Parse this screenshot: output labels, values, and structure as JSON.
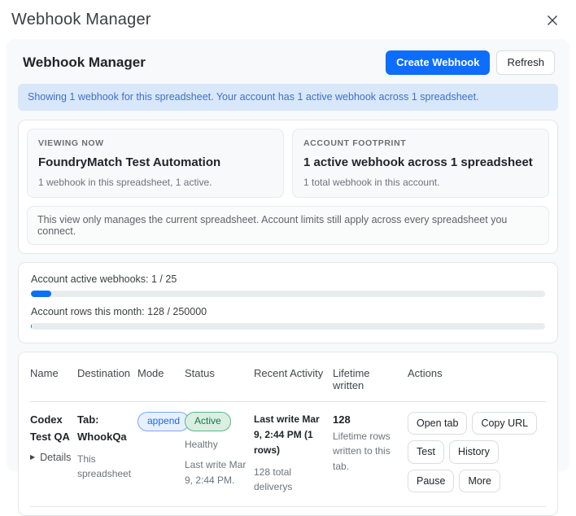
{
  "dialog": {
    "title": "Webhook Manager"
  },
  "header": {
    "title": "Webhook Manager",
    "create_button": "Create Webhook",
    "refresh_button": "Refresh"
  },
  "banner": {
    "text": "Showing 1 webhook for this spreadsheet. Your account has 1 active webhook across 1 spreadsheet."
  },
  "overview": {
    "viewing_now": {
      "label": "VIEWING NOW",
      "title": "FoundryMatch Test Automation",
      "subtitle": "1 webhook in this spreadsheet, 1 active."
    },
    "account_footprint": {
      "label": "ACCOUNT FOOTPRINT",
      "title": "1 active webhook across 1 spreadsheet",
      "subtitle": "1 total webhook in this account."
    },
    "note": "This view only manages the current spreadsheet. Account limits still apply across every spreadsheet you connect."
  },
  "quotas": {
    "webhooks": {
      "label": "Account active webhooks: 1 / 25",
      "used": 1,
      "limit": 25,
      "percent": 4
    },
    "rows": {
      "label": "Account rows this month: 128 / 250000",
      "used": 128,
      "limit": 250000,
      "percent": 0.05
    }
  },
  "table": {
    "headers": [
      "Name",
      "Destination",
      "Mode",
      "Status",
      "Recent Activity",
      "Lifetime written",
      "Actions"
    ],
    "row": {
      "name": "Codex Test QA",
      "details_label": "Details",
      "destination_primary": "Tab: WhookQa",
      "destination_secondary": "This spreadsheet",
      "mode_badge": "append",
      "status_badge": "Active",
      "status_health": "Healthy",
      "status_last_write": "Last write Mar 9, 2:44 PM.",
      "recent_primary": "Last write Mar 9, 2:44 PM (1 rows)",
      "recent_secondary": "128 total deliverys",
      "lifetime_value": "128",
      "lifetime_caption": "Lifetime rows written to this tab.",
      "actions": [
        "Open tab",
        "Copy URL",
        "Test",
        "History",
        "Pause",
        "More"
      ]
    }
  },
  "icons": {
    "close": "x-close-icon",
    "details_caret": "caret-right-icon"
  },
  "colors": {
    "primary": "#0d6efd",
    "panel_bg": "#f8f9fa",
    "card_border": "#e3e6ea",
    "banner_bg": "#d9e7fb",
    "banner_text": "#3e70c9",
    "badge_append_text": "#1d6ae5",
    "badge_active_text": "#19734a"
  }
}
